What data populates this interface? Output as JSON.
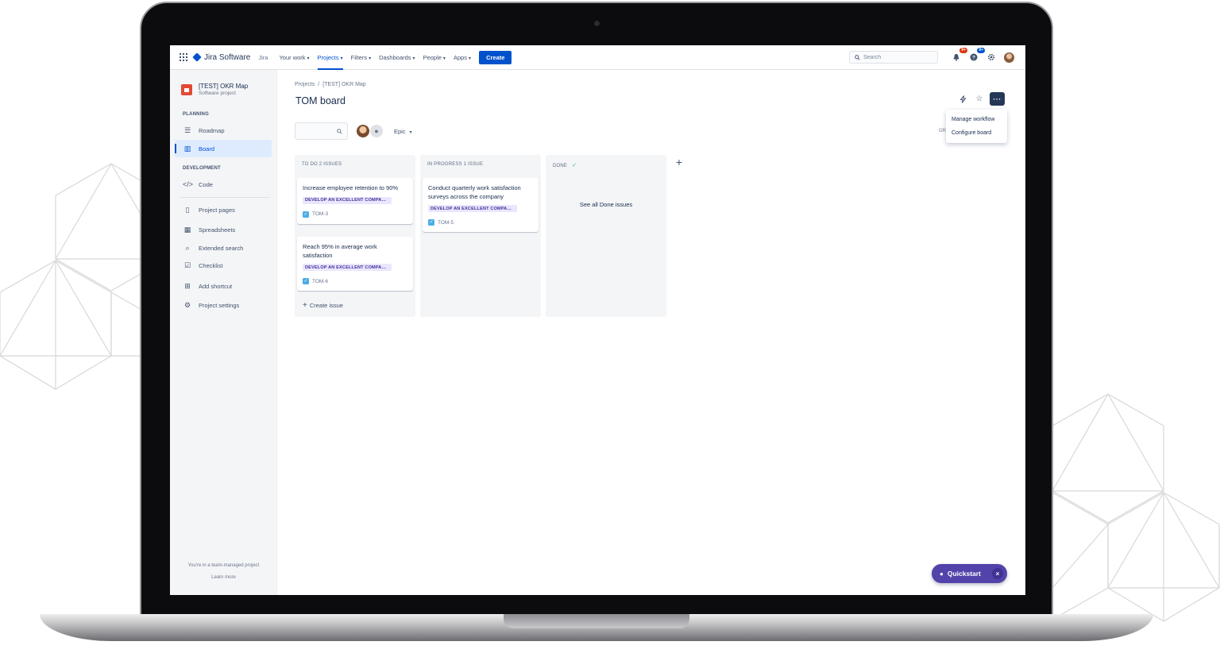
{
  "colors": {
    "brand_blue": "#0052CC",
    "nav_text": "#42526E",
    "sidebar_bg": "#F4F5F7",
    "epic_bg": "#EAE6FF",
    "epic_text": "#403294",
    "quickstart_bg": "#5243AA",
    "badge_red": "#DE350B"
  },
  "topnav": {
    "apps_icon": "app-switcher-grid-icon",
    "logo_text": "Jira Software",
    "product_label": "Jira",
    "items": [
      {
        "label": "Your work",
        "active": false
      },
      {
        "label": "Projects",
        "active": true
      },
      {
        "label": "Filters",
        "active": false
      },
      {
        "label": "Dashboards",
        "active": false
      },
      {
        "label": "People",
        "active": false
      },
      {
        "label": "Apps",
        "active": false
      }
    ],
    "create_label": "Create",
    "search_placeholder": "Search",
    "notifications_badge": "9+",
    "help_badge": "9+"
  },
  "sidebar": {
    "project_name": "[TEST] OKR Map",
    "project_type": "Software project",
    "planning_title": "PLANNING",
    "planning_items": [
      {
        "label": "Roadmap",
        "icon": "roadmap-icon",
        "active": false
      },
      {
        "label": "Board",
        "icon": "board-icon",
        "active": true
      }
    ],
    "development_title": "DEVELOPMENT",
    "development_items": [
      {
        "label": "Code",
        "icon": "code-icon",
        "active": false
      }
    ],
    "other_items": [
      {
        "label": "Project pages",
        "icon": "page-icon"
      },
      {
        "label": "Spreadsheets",
        "icon": "spreadsheet-icon"
      },
      {
        "label": "Extended search",
        "icon": "jql-search-icon"
      },
      {
        "label": "Checklist",
        "icon": "checklist-icon"
      },
      {
        "label": "Add shortcut",
        "icon": "add-shortcut-icon"
      },
      {
        "label": "Project settings",
        "icon": "gear-icon"
      }
    ],
    "footer_text": "You're in a team-managed project",
    "footer_link": "Learn more"
  },
  "main": {
    "breadcrumb": [
      "Projects",
      "[TEST] OKR Map"
    ],
    "title": "TOM board",
    "menu_items": [
      "Manage workflow",
      "Configure board"
    ],
    "group_label": "GR",
    "epic_filter_label": "Epic",
    "columns": [
      {
        "header": "TO DO 2 ISSUES",
        "cards": [
          {
            "title": "Increase employee retention to 90%",
            "epic": "DEVELOP AN EXCELLENT COMPANY CULTURE",
            "key": "TOM-3"
          },
          {
            "title": "Reach 95% in average work satisfaction",
            "epic": "DEVELOP AN EXCELLENT COMPANY CULTURE",
            "key": "TOM-6"
          }
        ],
        "create_label": "Create issue"
      },
      {
        "header": "IN PROGRESS 1 ISSUE",
        "cards": [
          {
            "title": "Conduct quarterly work satisfaction surveys across the company",
            "epic": "DEVELOP AN EXCELLENT COMPANY CULTURE",
            "key": "TOM-5"
          }
        ]
      },
      {
        "header": "DONE",
        "see_all": "See all Done issues"
      }
    ],
    "quickstart_label": "Quickstart"
  }
}
